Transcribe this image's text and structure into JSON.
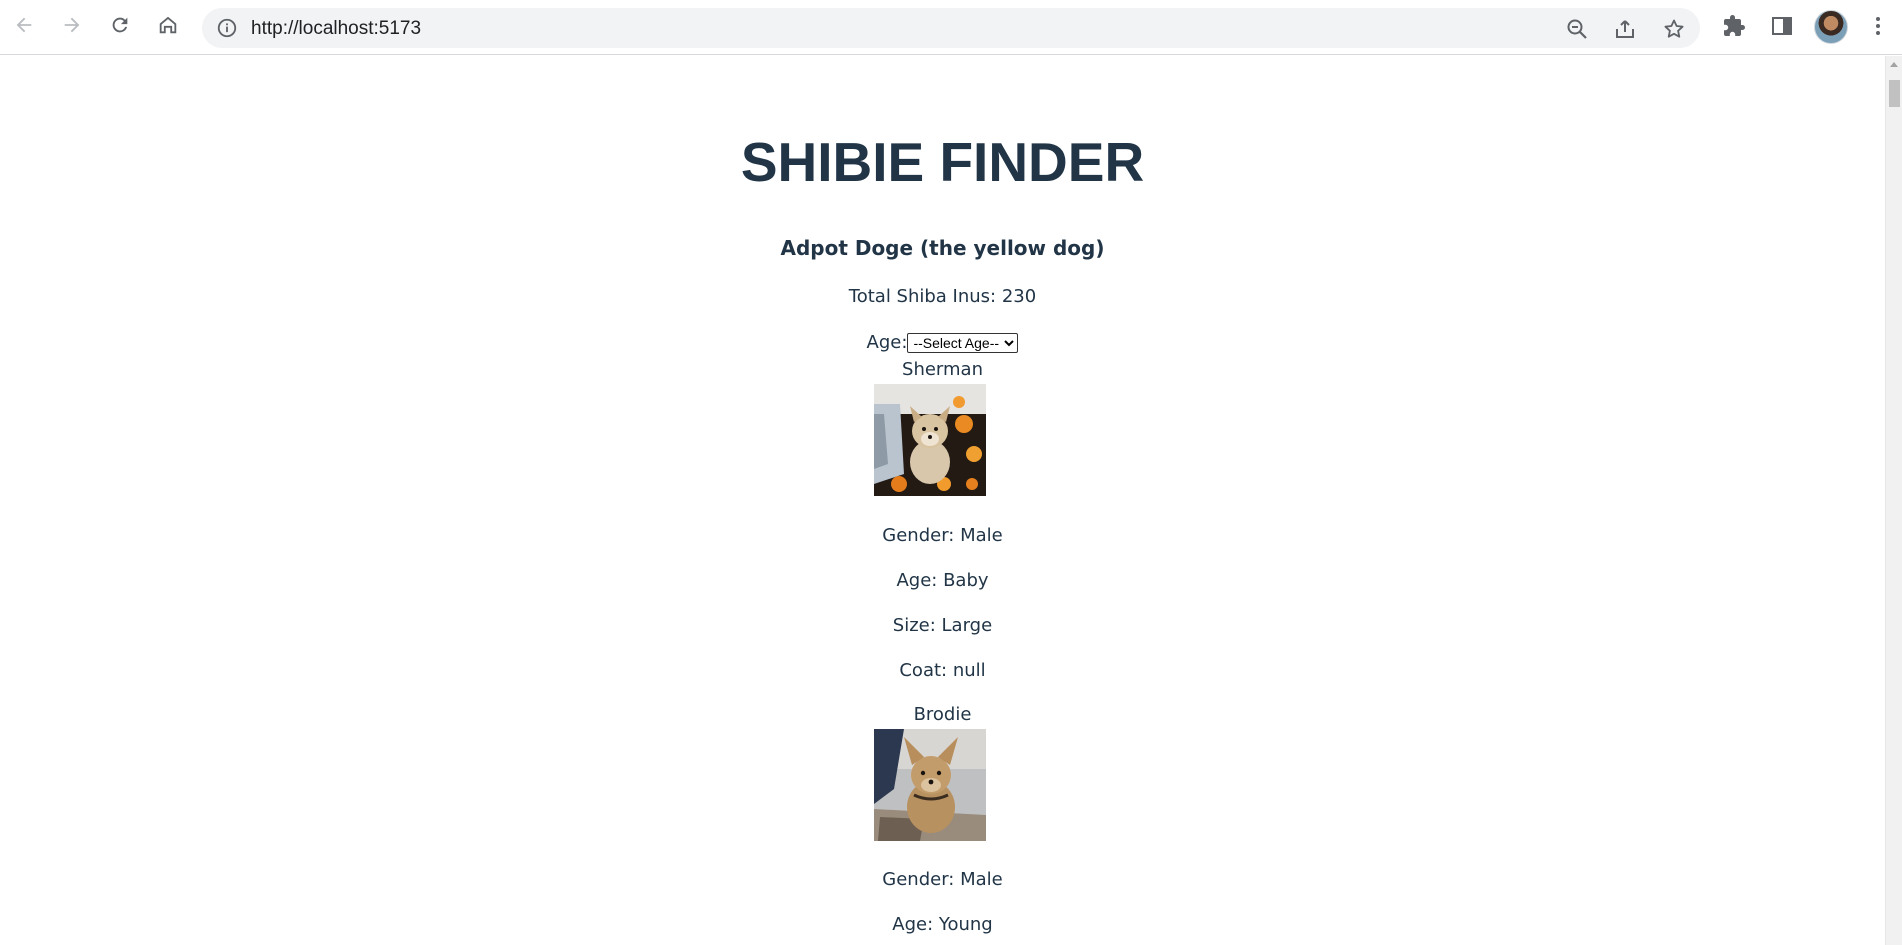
{
  "browser": {
    "url": "http://localhost:5173"
  },
  "page": {
    "title": "SHIBIE FINDER",
    "subtitle": "Adpot Doge (the yellow dog)",
    "total": "Total Shiba Inus: 230",
    "age_filter": {
      "label": "Age:",
      "selected": "--Select Age--"
    },
    "dogs": [
      {
        "name": "Sherman",
        "gender": "Gender: Male",
        "age": "Age: Baby",
        "size": "Size: Large",
        "coat": "Coat: null"
      },
      {
        "name": "Brodie",
        "gender": "Gender: Male",
        "age": "Age: Young"
      }
    ]
  },
  "colors": {
    "text": "#213547",
    "chrome_bg": "#ffffff",
    "omnibox_bg": "#f1f3f4"
  },
  "icons": [
    "back-arrow-icon",
    "forward-arrow-icon",
    "reload-icon",
    "home-icon",
    "info-icon",
    "zoom-out-icon",
    "share-icon",
    "star-icon",
    "extensions-icon",
    "side-panel-icon",
    "menu-icon"
  ]
}
